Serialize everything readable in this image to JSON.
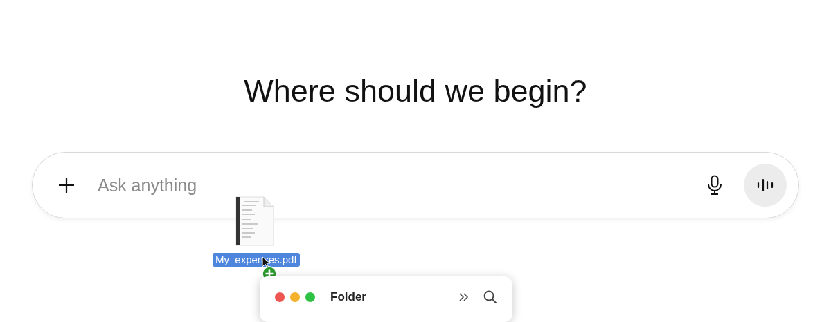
{
  "heading": "Where should we begin?",
  "composer": {
    "placeholder": "Ask anything"
  },
  "dragged_file": {
    "name": "My_expenses.pdf"
  },
  "folder_window": {
    "title": "Folder"
  }
}
